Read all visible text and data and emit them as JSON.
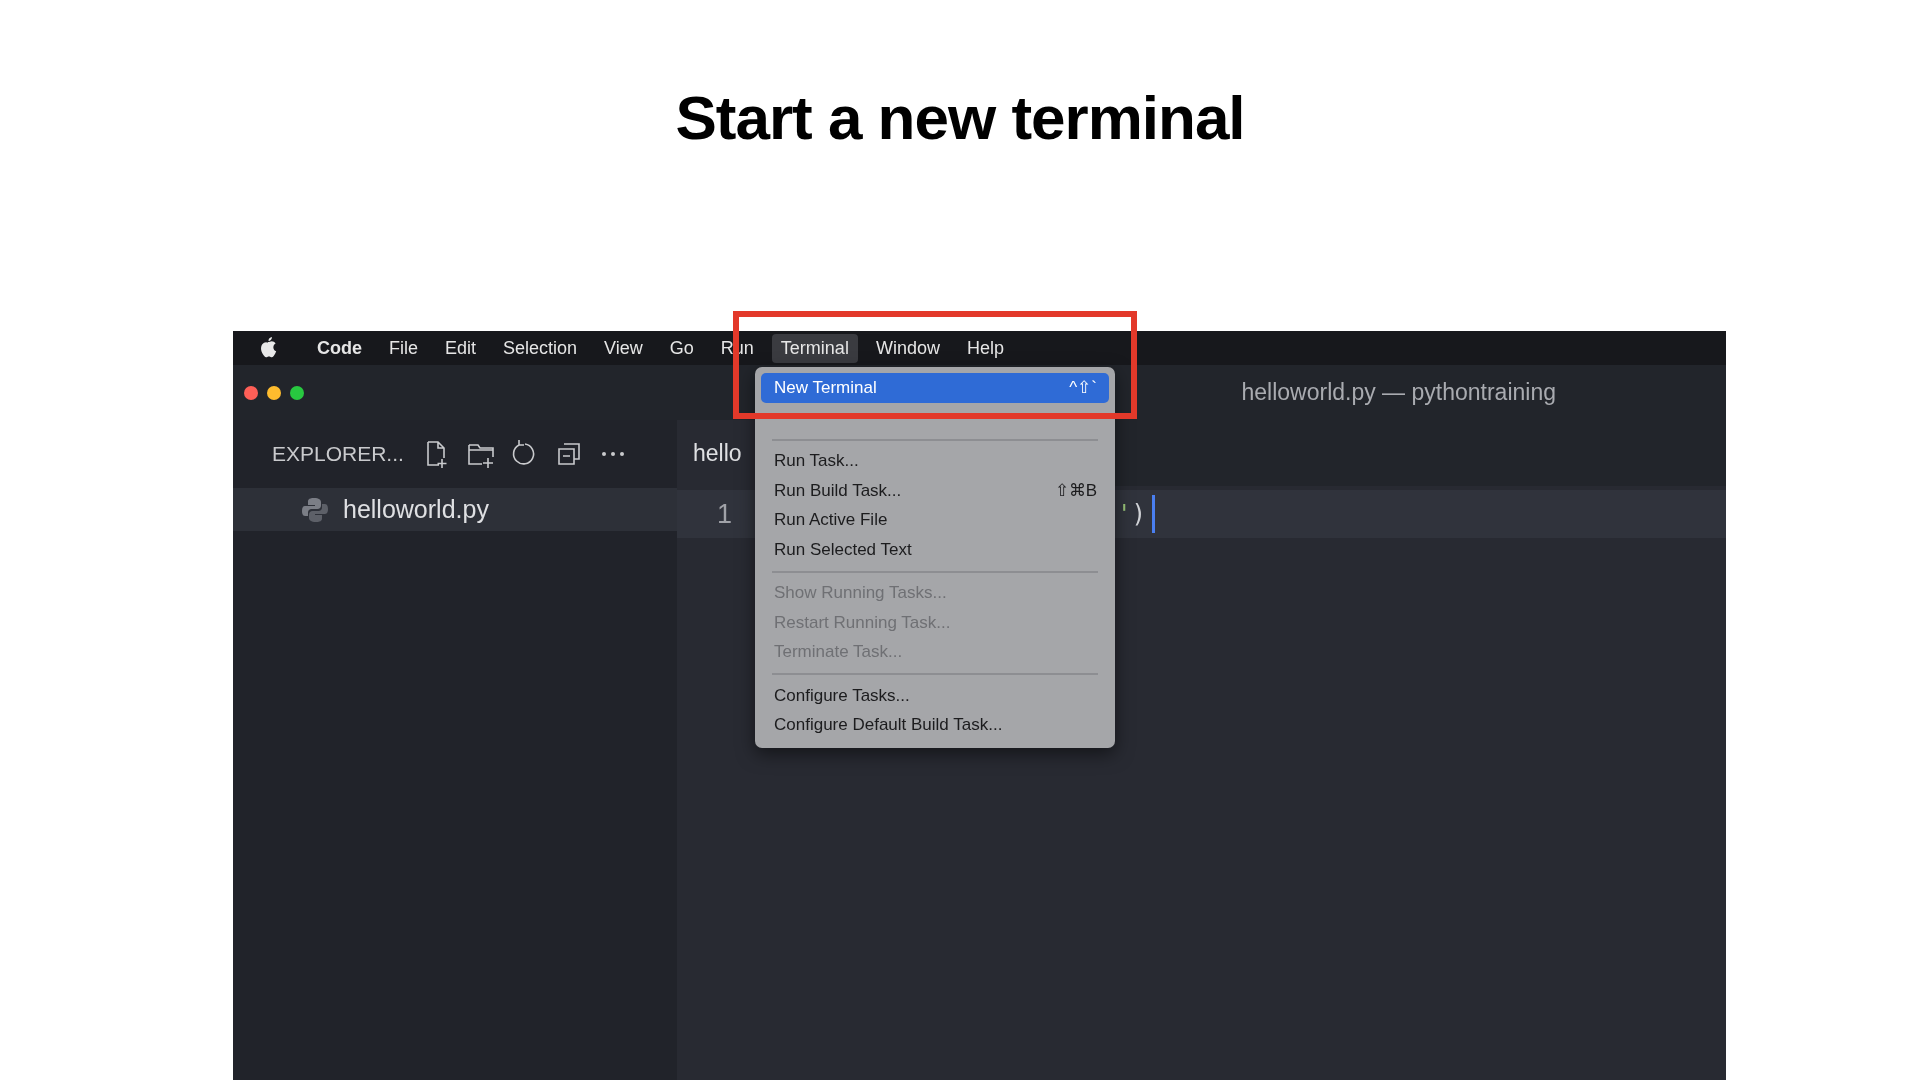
{
  "slide_title": "Start a new terminal",
  "menu_bar": {
    "items": [
      {
        "label": "Code",
        "kind": "app",
        "selected": false
      },
      {
        "label": "File",
        "kind": "menu",
        "selected": false
      },
      {
        "label": "Edit",
        "kind": "menu",
        "selected": false
      },
      {
        "label": "Selection",
        "kind": "menu",
        "selected": false
      },
      {
        "label": "View",
        "kind": "menu",
        "selected": false
      },
      {
        "label": "Go",
        "kind": "menu",
        "selected": false
      },
      {
        "label": "Run",
        "kind": "menu",
        "selected": false
      },
      {
        "label": "Terminal",
        "kind": "menu",
        "selected": true
      },
      {
        "label": "Window",
        "kind": "menu",
        "selected": false
      },
      {
        "label": "Help",
        "kind": "menu",
        "selected": false
      }
    ]
  },
  "window": {
    "title": "helloworld.py — pythontraining"
  },
  "sidebar": {
    "header": "EXPLORER...",
    "files": [
      {
        "name": "helloworld.py",
        "selected": true
      }
    ]
  },
  "editor": {
    "tab": "hello",
    "lines": [
      {
        "number": "1",
        "tokens": [
          {
            "text": "'",
            "kind": "string"
          },
          {
            "text": ")",
            "kind": "punct"
          }
        ]
      }
    ]
  },
  "dropdown": {
    "items": [
      {
        "kind": "item",
        "label": "New Terminal",
        "shortcut": "^⇧`",
        "selected": true,
        "disabled": false
      },
      {
        "kind": "separator"
      },
      {
        "kind": "item",
        "label": "Run Task...",
        "selected": false,
        "disabled": false
      },
      {
        "kind": "item",
        "label": "Run Build Task...",
        "shortcut": "⇧⌘B",
        "selected": false,
        "disabled": false
      },
      {
        "kind": "item",
        "label": "Run Active File",
        "selected": false,
        "disabled": false
      },
      {
        "kind": "item",
        "label": "Run Selected Text",
        "selected": false,
        "disabled": false
      },
      {
        "kind": "separator"
      },
      {
        "kind": "item",
        "label": "Show Running Tasks...",
        "selected": false,
        "disabled": true
      },
      {
        "kind": "item",
        "label": "Restart Running Task...",
        "selected": false,
        "disabled": true
      },
      {
        "kind": "item",
        "label": "Terminate Task...",
        "selected": false,
        "disabled": true
      },
      {
        "kind": "separator"
      },
      {
        "kind": "item",
        "label": "Configure Tasks...",
        "selected": false,
        "disabled": false
      },
      {
        "kind": "item",
        "label": "Configure Default Build Task...",
        "selected": false,
        "disabled": false
      }
    ]
  }
}
